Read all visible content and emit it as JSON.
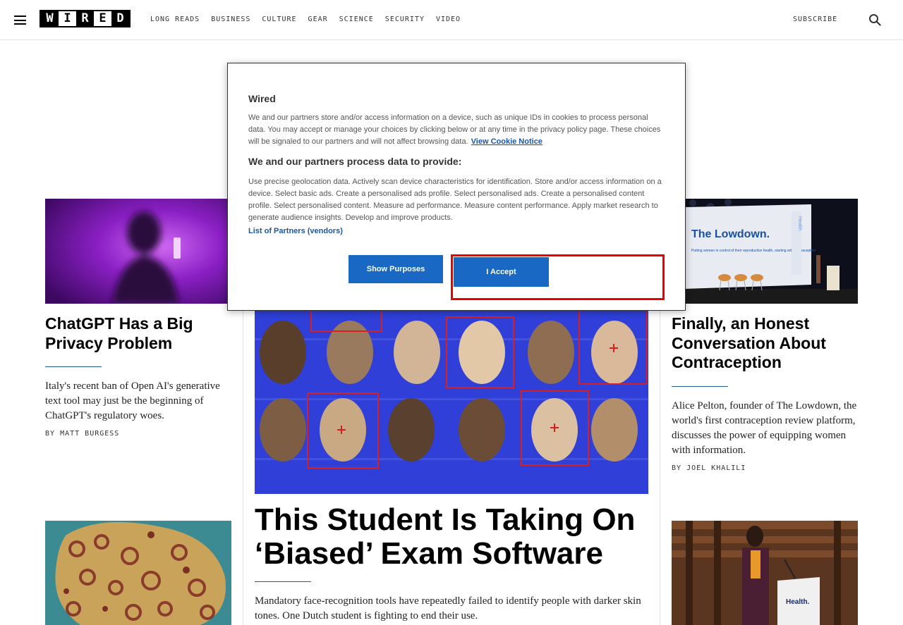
{
  "header": {
    "logo_letters": [
      "W",
      "I",
      "R",
      "E",
      "D"
    ],
    "nav": [
      "LONG READS",
      "BUSINESS",
      "CULTURE",
      "GEAR",
      "SCIENCE",
      "SECURITY",
      "VIDEO"
    ],
    "subscribe": "SUBSCRIBE"
  },
  "stories": {
    "left_top": {
      "headline": "ChatGPT Has a Big Privacy Problem",
      "dek": " Italy's recent ban of Open AI's generative text tool may just be the beginning of ChatGPT's regulatory woes.",
      "by": "BY",
      "author": "MATT BURGESS"
    },
    "center": {
      "headline": "This Student Is Taking On ‘Biased’ Exam Software",
      "dek": "Mandatory face-recognition tools have repeatedly failed to identify people with darker skin tones. One Dutch student is fighting to end their use."
    },
    "right_top": {
      "headline": "Finally, an Honest Conversation About Contraception",
      "dek": "Alice Pelton, founder of The Lowdown, the world's first contraception review platform, discusses the power of equipping women with information.",
      "by": "BY",
      "author": "JOEL KHALILI",
      "slide_title": "The Lowdown.",
      "slide_text": "Putting women in control of their reproductive health, starting with contraception",
      "banner_text": "Health."
    },
    "right_bottom": {
      "podium_text": "Health."
    }
  },
  "cookie_dialog": {
    "title": "Wired",
    "intro": "We and our partners store and/or access information on a device, such as unique IDs in cookies to process personal data. You may accept or manage your choices by clicking below or at any time in the privacy policy page. These choices will be signaled to our partners and will not affect browsing data.",
    "cookie_notice_link": "View Cookie Notice",
    "purposes_heading": "We and our partners process data to provide:",
    "purposes_text": "Use precise geolocation data. Actively scan device characteristics for identification. Store and/or access information on a device. Select basic ads. Create a personalised ads profile. Select personalised ads. Create a personalised content profile. Select personalised content. Measure ad performance. Measure content performance. Apply market research to generate audience insights. Develop and improve products.",
    "partners_link": "List of Partners (vendors)",
    "show_purposes_button": "Show Purposes",
    "accept_button": "I Accept"
  },
  "colors": {
    "accent_rule": "#1e5a8a",
    "button_blue": "#1868c4",
    "link_blue": "#1a56a6",
    "highlight_red": "#e00000"
  },
  "icons": [
    "hamburger-menu-icon",
    "search-icon"
  ]
}
